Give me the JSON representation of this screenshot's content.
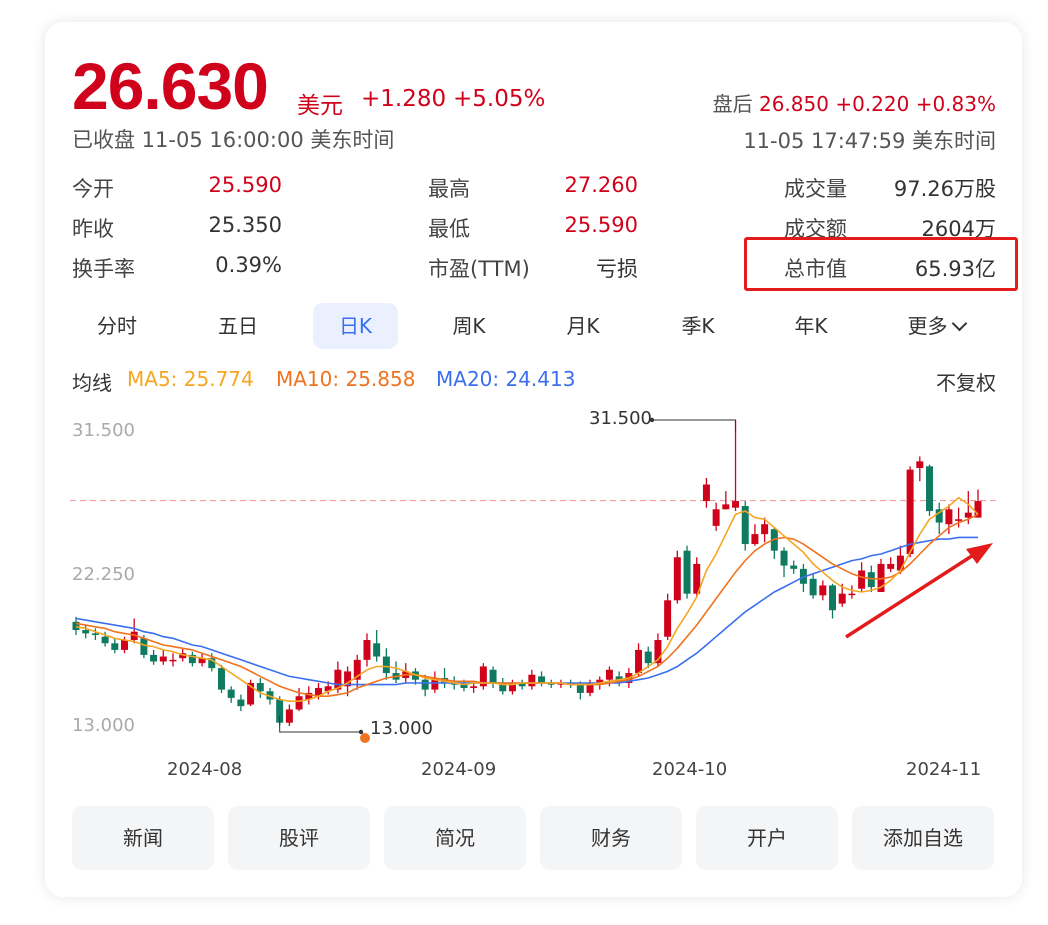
{
  "quote": {
    "price": "26.630",
    "currency": "美元",
    "change": "+1.280",
    "change_pct": "+5.05%",
    "status": "已收盘 11-05 16:00:00 美东时间",
    "after_hours_label": "盘后",
    "after_hours_price": "26.850",
    "after_hours_change": "+0.220",
    "after_hours_pct": "+0.83%",
    "after_hours_time": "11-05 17:47:59 美东时间"
  },
  "stats": {
    "open_label": "今开",
    "open": "25.590",
    "prev_label": "昨收",
    "prev": "25.350",
    "turnover_label": "换手率",
    "turnover": "0.39%",
    "high_label": "最高",
    "high": "27.260",
    "low_label": "最低",
    "low": "25.590",
    "pe_label": "市盈(TTM)",
    "pe": "亏损",
    "volume_label": "成交量",
    "volume": "97.26万股",
    "amount_label": "成交额",
    "amount": "2604万",
    "mktcap_label": "总市值",
    "mktcap": "65.93亿"
  },
  "tabs": [
    "分时",
    "五日",
    "日K",
    "周K",
    "月K",
    "季K",
    "年K",
    "更多"
  ],
  "active_tab": "日K",
  "ma": {
    "title": "均线",
    "ma5": "MA5: 25.774",
    "ma10": "MA10: 25.858",
    "ma20": "MA20: 24.413",
    "adjust": "不复权"
  },
  "colors": {
    "up": "#d0021b",
    "down": "#0f7a60",
    "ma5": "#f5a623",
    "ma10": "#f0731f",
    "ma20": "#3b6ff0",
    "accent": "#3b6ff0",
    "annotation": "#e31b1b"
  },
  "chart_data": {
    "type": "candlestick",
    "y_ticks": [
      "31.500",
      "22.250",
      "13.000"
    ],
    "x_ticks": [
      "2024-08",
      "2024-09",
      "2024-10",
      "2024-11"
    ],
    "ylim": [
      13.0,
      31.5
    ],
    "max_label": "31.500",
    "min_label": "13.000",
    "last_close": 26.63,
    "candles": [
      [
        19.3,
        18.8,
        19.6,
        18.5
      ],
      [
        18.8,
        18.6,
        19.1,
        18.3
      ],
      [
        18.6,
        18.5,
        18.9,
        18.2
      ],
      [
        18.4,
        18.0,
        18.7,
        17.8
      ],
      [
        18.0,
        17.6,
        18.3,
        17.4
      ],
      [
        17.6,
        18.2,
        18.4,
        17.4
      ],
      [
        18.2,
        18.7,
        19.5,
        18.0
      ],
      [
        18.3,
        17.3,
        18.5,
        17.1
      ],
      [
        17.3,
        16.9,
        17.6,
        16.7
      ],
      [
        16.9,
        17.2,
        17.6,
        16.7
      ],
      [
        17.0,
        17.0,
        17.4,
        16.6
      ],
      [
        17.1,
        17.4,
        17.7,
        16.9
      ],
      [
        17.3,
        16.8,
        17.5,
        16.6
      ],
      [
        16.8,
        17.1,
        17.4,
        16.6
      ],
      [
        17.1,
        16.5,
        17.4,
        16.3
      ],
      [
        16.5,
        15.2,
        16.7,
        15.0
      ],
      [
        15.2,
        14.7,
        15.4,
        14.4
      ],
      [
        14.6,
        14.2,
        14.9,
        13.9
      ],
      [
        14.3,
        15.6,
        15.8,
        14.2
      ],
      [
        15.6,
        15.1,
        15.9,
        14.7
      ],
      [
        15.1,
        14.6,
        15.3,
        14.3
      ],
      [
        14.6,
        13.2,
        14.8,
        13.0
      ],
      [
        13.2,
        14.0,
        14.3,
        13.0
      ],
      [
        14.0,
        14.8,
        15.3,
        13.9
      ],
      [
        14.6,
        15.0,
        15.4,
        14.3
      ],
      [
        14.8,
        15.3,
        15.6,
        14.6
      ],
      [
        15.1,
        15.4,
        15.7,
        14.9
      ],
      [
        15.2,
        16.4,
        16.9,
        15.0
      ],
      [
        15.4,
        16.3,
        16.6,
        14.8
      ],
      [
        15.8,
        17.0,
        17.3,
        15.2
      ],
      [
        17.0,
        18.2,
        18.6,
        16.6
      ],
      [
        18.0,
        17.2,
        18.8,
        16.9
      ],
      [
        17.2,
        16.2,
        17.7,
        15.8
      ],
      [
        16.2,
        15.8,
        16.9,
        15.6
      ],
      [
        15.9,
        16.3,
        16.8,
        15.6
      ],
      [
        16.3,
        15.8,
        16.5,
        15.5
      ],
      [
        15.8,
        15.2,
        16.1,
        14.8
      ],
      [
        15.2,
        15.9,
        16.3,
        15.0
      ],
      [
        15.9,
        15.6,
        16.5,
        15.3
      ],
      [
        15.6,
        15.5,
        16.0,
        15.2
      ],
      [
        15.5,
        15.3,
        15.8,
        15.1
      ],
      [
        15.3,
        15.4,
        15.7,
        15.0
      ],
      [
        15.4,
        16.6,
        16.8,
        15.2
      ],
      [
        16.4,
        15.6,
        16.6,
        15.3
      ],
      [
        15.6,
        15.1,
        15.9,
        14.9
      ],
      [
        15.1,
        15.6,
        15.8,
        14.9
      ],
      [
        15.6,
        15.4,
        15.8,
        15.2
      ],
      [
        15.4,
        16.1,
        16.4,
        15.2
      ],
      [
        16.0,
        15.6,
        16.3,
        15.4
      ],
      [
        15.6,
        15.5,
        15.8,
        15.3
      ],
      [
        15.5,
        15.6,
        15.8,
        15.3
      ],
      [
        15.6,
        15.5,
        15.8,
        15.3
      ],
      [
        15.5,
        15.0,
        15.7,
        14.6
      ],
      [
        15.0,
        15.6,
        15.8,
        14.8
      ],
      [
        15.5,
        15.8,
        16.0,
        15.2
      ],
      [
        15.8,
        16.4,
        16.6,
        15.4
      ],
      [
        16.0,
        15.6,
        16.3,
        15.4
      ],
      [
        15.6,
        16.2,
        16.5,
        15.3
      ],
      [
        16.2,
        17.6,
        18.0,
        16.0
      ],
      [
        17.5,
        16.8,
        17.8,
        16.5
      ],
      [
        16.8,
        18.2,
        18.6,
        16.6
      ],
      [
        18.4,
        20.6,
        21.0,
        18.2
      ],
      [
        20.6,
        23.2,
        23.6,
        20.4
      ],
      [
        23.6,
        21.0,
        23.9,
        20.7
      ],
      [
        21.0,
        22.8,
        23.2,
        20.8
      ],
      [
        26.6,
        27.6,
        28.0,
        26.2
      ],
      [
        25.1,
        26.1,
        26.5,
        24.8
      ],
      [
        26.1,
        26.4,
        27.2,
        26.1
      ],
      [
        26.2,
        26.6,
        31.5,
        26.0
      ],
      [
        26.3,
        24.0,
        26.6,
        23.6
      ],
      [
        24.0,
        24.6,
        25.2,
        23.9
      ],
      [
        24.6,
        25.2,
        25.6,
        24.1
      ],
      [
        24.9,
        23.6,
        25.0,
        23.1
      ],
      [
        23.6,
        22.7,
        23.8,
        22.0
      ],
      [
        22.7,
        22.5,
        23.0,
        22.2
      ],
      [
        22.5,
        21.6,
        22.8,
        21.1
      ],
      [
        21.9,
        20.9,
        22.2,
        20.7
      ],
      [
        20.9,
        21.5,
        21.8,
        20.6
      ],
      [
        21.5,
        20.0,
        21.6,
        19.5
      ],
      [
        20.4,
        21.0,
        21.6,
        20.2
      ],
      [
        21.0,
        21.0,
        21.5,
        20.7
      ],
      [
        21.3,
        22.4,
        22.9,
        21.1
      ],
      [
        22.3,
        21.4,
        22.7,
        21.1
      ],
      [
        21.1,
        22.8,
        23.1,
        21.1
      ],
      [
        22.5,
        22.8,
        23.2,
        22.3
      ],
      [
        22.4,
        23.3,
        23.9,
        22.2
      ],
      [
        23.4,
        28.5,
        28.7,
        23.2
      ],
      [
        28.6,
        29.0,
        29.3,
        27.8
      ],
      [
        28.7,
        26.0,
        28.8,
        25.7
      ],
      [
        26.1,
        25.3,
        26.5,
        24.6
      ],
      [
        25.2,
        26.1,
        26.4,
        24.6
      ],
      [
        25.4,
        25.5,
        26.2,
        25.0
      ],
      [
        25.6,
        25.9,
        27.2,
        25.2
      ],
      [
        25.6,
        26.6,
        27.3,
        25.6
      ]
    ],
    "ma5": [
      19.0,
      18.9,
      18.7,
      18.5,
      18.3,
      18.2,
      18.1,
      17.9,
      17.8,
      17.6,
      17.5,
      17.3,
      17.2,
      17.1,
      17.0,
      16.6,
      16.2,
      15.8,
      15.4,
      15.0,
      14.8,
      14.6,
      14.5,
      14.5,
      14.6,
      14.8,
      15.1,
      15.3,
      15.6,
      16.0,
      16.4,
      16.6,
      16.6,
      16.5,
      16.3,
      16.1,
      15.9,
      15.8,
      15.7,
      15.6,
      15.5,
      15.6,
      15.6,
      15.6,
      15.5,
      15.5,
      15.6,
      15.6,
      15.6,
      15.6,
      15.6,
      15.5,
      15.5,
      15.5,
      15.6,
      15.7,
      15.8,
      15.9,
      16.2,
      16.6,
      17.0,
      17.8,
      18.9,
      19.8,
      20.8,
      22.4,
      23.4,
      24.6,
      25.8,
      26.0,
      25.6,
      25.5,
      25.0,
      24.5,
      24.0,
      23.5,
      22.8,
      22.3,
      21.8,
      21.4,
      21.2,
      21.1,
      21.2,
      21.4,
      21.8,
      22.4,
      23.5,
      24.6,
      25.5,
      25.9,
      26.3,
      26.8,
      26.4,
      25.8
    ],
    "ma10": [
      19.2,
      19.1,
      19.0,
      18.9,
      18.7,
      18.6,
      18.5,
      18.3,
      18.1,
      17.9,
      17.8,
      17.7,
      17.6,
      17.4,
      17.2,
      17.0,
      16.8,
      16.6,
      16.3,
      16.0,
      15.7,
      15.4,
      15.2,
      15.0,
      14.9,
      14.8,
      14.8,
      14.9,
      15.0,
      15.3,
      15.5,
      15.7,
      15.9,
      16.0,
      16.1,
      16.1,
      16.0,
      15.9,
      15.8,
      15.7,
      15.7,
      15.7,
      15.6,
      15.6,
      15.6,
      15.6,
      15.6,
      15.6,
      15.6,
      15.6,
      15.6,
      15.5,
      15.5,
      15.5,
      15.5,
      15.6,
      15.7,
      15.8,
      16.0,
      16.3,
      16.6,
      17.1,
      17.7,
      18.4,
      19.1,
      19.9,
      20.7,
      21.5,
      22.3,
      23.0,
      23.6,
      24.0,
      24.3,
      24.4,
      24.3,
      24.0,
      23.6,
      23.2,
      22.8,
      22.5,
      22.2,
      22.0,
      21.9,
      21.9,
      22.0,
      22.3,
      22.8,
      23.4,
      24.0,
      24.5,
      25.0,
      25.3,
      25.5,
      25.8
    ],
    "ma20": [
      19.5,
      19.4,
      19.3,
      19.2,
      19.1,
      19.0,
      18.9,
      18.7,
      18.6,
      18.4,
      18.3,
      18.1,
      17.9,
      17.8,
      17.6,
      17.4,
      17.2,
      17.0,
      16.8,
      16.6,
      16.4,
      16.2,
      16.0,
      15.9,
      15.8,
      15.7,
      15.6,
      15.5,
      15.5,
      15.5,
      15.5,
      15.5,
      15.5,
      15.5,
      15.6,
      15.6,
      15.6,
      15.6,
      15.6,
      15.6,
      15.6,
      15.6,
      15.6,
      15.6,
      15.6,
      15.6,
      15.6,
      15.6,
      15.6,
      15.6,
      15.6,
      15.6,
      15.6,
      15.6,
      15.6,
      15.6,
      15.6,
      15.7,
      15.8,
      15.9,
      16.1,
      16.3,
      16.6,
      17.0,
      17.4,
      17.9,
      18.4,
      18.9,
      19.4,
      19.9,
      20.3,
      20.7,
      21.1,
      21.4,
      21.7,
      22.0,
      22.2,
      22.4,
      22.6,
      22.8,
      23.0,
      23.1,
      23.3,
      23.4,
      23.6,
      23.8,
      24.0,
      24.1,
      24.2,
      24.3,
      24.3,
      24.4,
      24.4,
      24.4
    ]
  },
  "actions": [
    "新闻",
    "股评",
    "简况",
    "财务",
    "开户",
    "添加自选"
  ]
}
